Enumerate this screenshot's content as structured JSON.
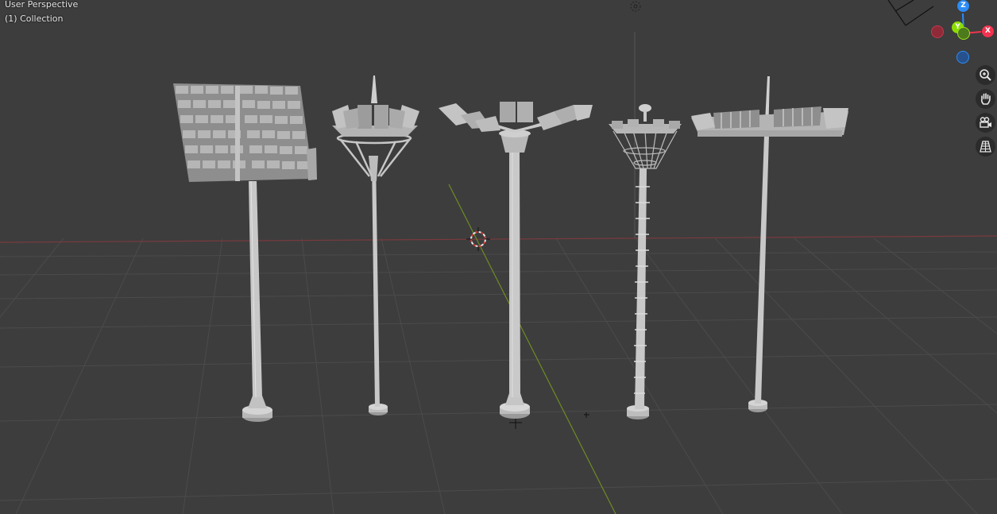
{
  "viewport": {
    "view_label": "User Perspective",
    "collection_label": "(1) Collection"
  },
  "gizmo": {
    "z_label": "Z",
    "y_label": "Y",
    "x_label": "X",
    "colors": {
      "x": "#f3334f",
      "y": "#8bdc00",
      "z": "#2d8cf5",
      "x_neg": "#8f2a38",
      "y_neg": "#4c7a1c",
      "z_neg": "#26518c"
    }
  },
  "nav_buttons": [
    {
      "name": "zoom-icon"
    },
    {
      "name": "hand-pan-icon"
    },
    {
      "name": "camera-icon"
    },
    {
      "name": "perspective-grid-icon"
    }
  ],
  "scene": {
    "objects": [
      "floodlight-pole-solar",
      "floodlight-pole-ring",
      "floodlight-pole-crown",
      "floodlight-pole-ladder",
      "floodlight-pole-flat"
    ]
  }
}
